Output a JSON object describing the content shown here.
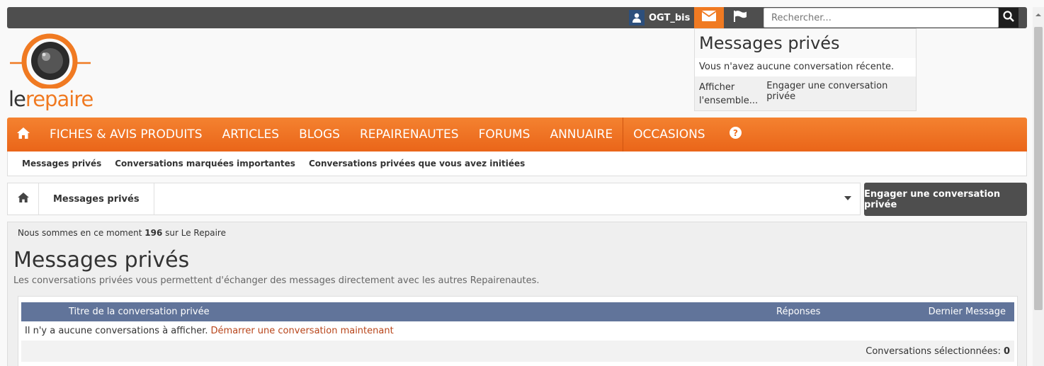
{
  "topbar": {
    "username": "OGT_bis",
    "search_placeholder": "Rechercher..."
  },
  "logo": {
    "part1": "le",
    "part2": "repaire"
  },
  "dropdown": {
    "title": "Messages privés",
    "empty": "Vous n'avez aucune conversation récente.",
    "show_all": "Afficher l'ensemble...",
    "start": "Engager une conversation privée"
  },
  "nav": {
    "items": [
      "FICHES & AVIS PRODUITS",
      "ARTICLES",
      "BLOGS",
      "REPAIRENAUTES",
      "FORUMS",
      "ANNUAIRE",
      "OCCASIONS"
    ]
  },
  "subnav": {
    "items": [
      "Messages privés",
      "Conversations marquées importantes",
      "Conversations privées que vous avez initiées"
    ]
  },
  "breadcrumb": {
    "current": "Messages privés"
  },
  "start_button": "Engager une conversation privée",
  "content": {
    "online_prefix": "Nous sommes en ce moment",
    "online_count": "196",
    "online_suffix": "sur Le Repaire",
    "title": "Messages privés",
    "description": "Les conversations privées vous permettent d'échanger des messages directement avec les autres Repairenautes.",
    "table": {
      "col_title": "Titre de la conversation privée",
      "col_replies": "Réponses",
      "col_last": "Dernier Message",
      "empty_text": "Il n'y a aucune conversations à afficher.",
      "empty_link": "Démarrer une conversation maintenant",
      "selected_label": "Conversations sélectionnées:",
      "selected_count": "0"
    }
  },
  "colors": {
    "accent": "#f07a22",
    "topbar": "#4e4e4e",
    "table_header": "#61749a"
  }
}
